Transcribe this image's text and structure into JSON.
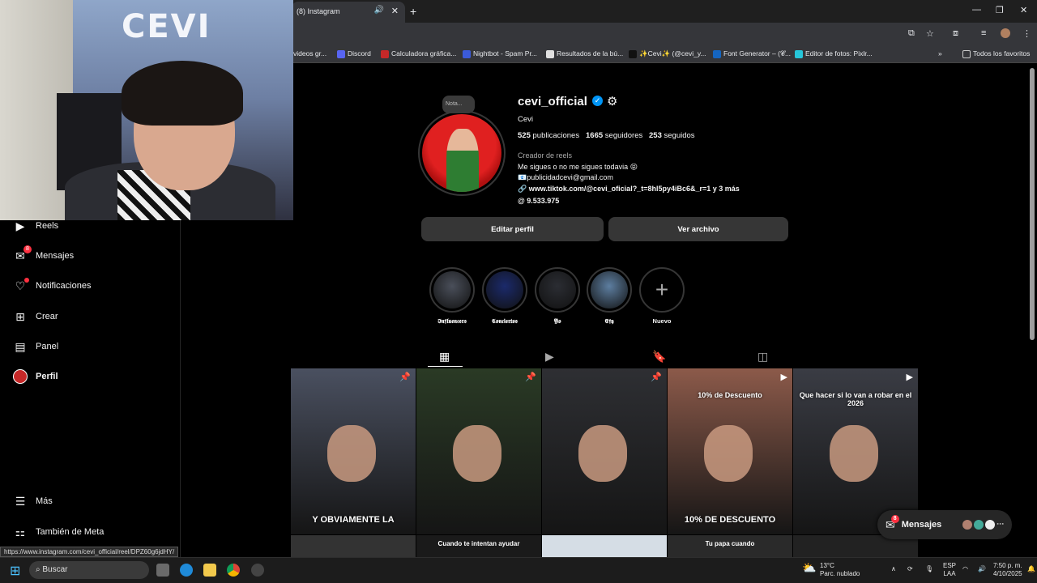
{
  "browser": {
    "tab_title": "(8) Instagram",
    "new_tab": "+",
    "bookmarks": [
      {
        "label": "videos gr...",
        "color": "#ffffff"
      },
      {
        "label": "Discord",
        "color": "#5865f2"
      },
      {
        "label": "Calculadora gráfica...",
        "color": "#c62828"
      },
      {
        "label": "Nightbot - Spam Pr...",
        "color": "#3b5bdb"
      },
      {
        "label": "Resultados de la bú...",
        "color": "#e0e0e0"
      },
      {
        "label": "✨Cevi✨ (@cevi_y...",
        "color": "#111111"
      },
      {
        "label": "Font Generator – (𝓒...",
        "color": "#1565c0"
      },
      {
        "label": "Editor de fotos: Pixlr...",
        "color": "#26c6da"
      }
    ],
    "bookmarks_more": "»",
    "all_bookmarks": "Todos los favoritos",
    "status_url": "https://www.instagram.com/cevi_official/reel/DPZ60g6jdHY/"
  },
  "webcam": {
    "logo_text": "CEVI"
  },
  "nav": [
    {
      "label": "Reels",
      "icon": "reels-icon",
      "glyph": "▶"
    },
    {
      "label": "Mensajes",
      "icon": "messenger-icon",
      "glyph": "✉",
      "badge": "8"
    },
    {
      "label": "Notificaciones",
      "icon": "heart-icon",
      "glyph": "♡",
      "dot": true
    },
    {
      "label": "Crear",
      "icon": "plus-square-icon",
      "glyph": "⊞"
    },
    {
      "label": "Panel",
      "icon": "dashboard-icon",
      "glyph": "▤"
    },
    {
      "label": "Perfil",
      "icon": "profile-avatar-icon",
      "glyph": "●",
      "active": true
    },
    {
      "label": "Más",
      "icon": "menu-icon",
      "glyph": "☰"
    },
    {
      "label": "También de Meta",
      "icon": "meta-grid-icon",
      "glyph": "⚏"
    }
  ],
  "profile": {
    "note": "Nota...",
    "username": "cevi_official",
    "verified_glyph": "✓",
    "full_name": "Cevi",
    "stats": {
      "posts": "525",
      "posts_label": "publicaciones",
      "followers": "1665",
      "followers_label": "seguidores",
      "following": "253",
      "following_label": "seguidos"
    },
    "category": "Creador de reels",
    "bio_line1": "Me sigues o no me sigues todavia 😝",
    "bio_line2": "📧publicidadcevi@gmail.com",
    "link": "🔗 www.tiktok.com/@cevi_oficial?_t=8hl5py4iBc6&_r=1 y 3 más",
    "threads": "@ 9.533.975",
    "edit_button": "Editar perfil",
    "archive_button": "Ver archivo"
  },
  "highlights": [
    {
      "label": "𝕴𝖓𝖋𝖑𝖚𝖊𝖓𝖈𝖊𝖗𝖘",
      "color": "#4a4f5a"
    },
    {
      "label": "𝕮𝖔𝖓𝖈𝖎𝖊𝖗𝖙𝖔𝖘",
      "color": "#1b2a6b"
    },
    {
      "label": "𝖄𝖔",
      "color": "#2b2d33"
    },
    {
      "label": "𝕰𝖋𝖞",
      "color": "#5d7ea0"
    },
    {
      "label": "Nuevo",
      "color": "#000000"
    }
  ],
  "tabs": [
    {
      "name": "grid",
      "glyph": "▦",
      "active": true
    },
    {
      "name": "reels",
      "glyph": "▶"
    },
    {
      "name": "saved",
      "glyph": "🔖"
    },
    {
      "name": "tagged",
      "glyph": "◫"
    }
  ],
  "posts": [
    {
      "caption": "Y OBVIAMENTE LA",
      "pin": "📌",
      "bg": "#4a5060"
    },
    {
      "caption": "",
      "pin": "📌",
      "bg": "#2a3a25"
    },
    {
      "caption": "",
      "pin": "📌",
      "bg": "#2e2f33"
    },
    {
      "caption": "10% DE DESCUENTO",
      "top_text": "10% de Descuento",
      "pin": "▶",
      "bg": "#8c5a4a"
    },
    {
      "caption": "",
      "top_text": "Que hacer si lo van a robar en el 2026",
      "pin": "▶",
      "bg": "#3a3c44"
    }
  ],
  "posts_row2": [
    {
      "caption": "",
      "bg": "#333"
    },
    {
      "caption": "Cuando te intentan ayudar",
      "bg": "#1a1a1a"
    },
    {
      "caption": "",
      "bg": "#d5dde5"
    },
    {
      "caption": "Tu papa cuando",
      "bg": "#2a2a2a"
    },
    {
      "caption": "",
      "bg": "#222"
    }
  ],
  "messages_pill": {
    "label": "Mensajes",
    "badge": "8"
  },
  "taskbar": {
    "search_placeholder": "Buscar",
    "weather_temp": "13°C",
    "weather_desc": "Parc. nublado",
    "lang1": "ESP",
    "lang2": "LAA",
    "time": "7:50 p. m.",
    "date": "4/10/2025"
  }
}
